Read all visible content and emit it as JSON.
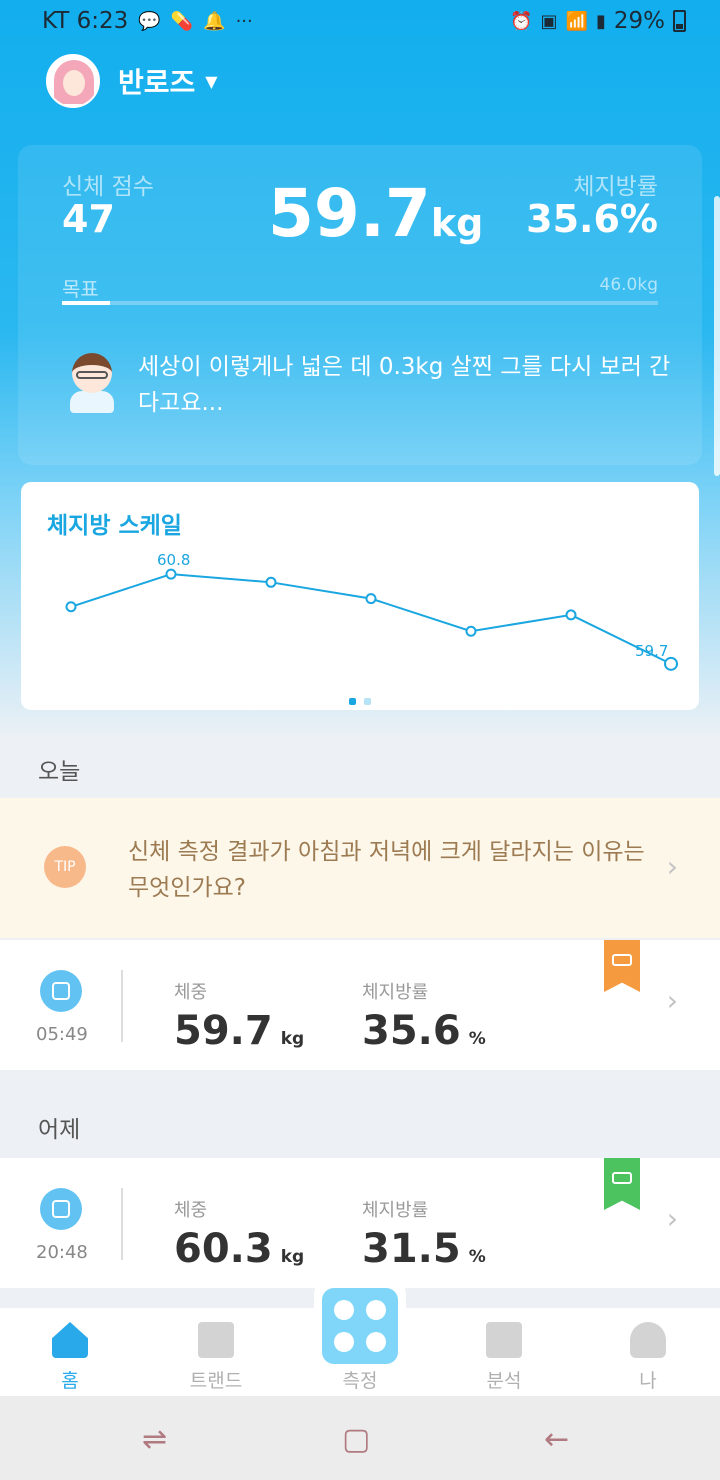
{
  "status_bar": {
    "left_text": "KT 6:23",
    "right_text": "29%",
    "icons": [
      "kakaotalk-icon",
      "pill-icon",
      "bell-icon",
      "more-icon",
      "alarm-icon",
      "hd-icon",
      "wifi-icon",
      "signal-icon",
      "battery-icon"
    ]
  },
  "profile": {
    "name": "반로즈"
  },
  "summary": {
    "score_label": "신체 점수",
    "score_value": "47",
    "weight_value": "59.7",
    "weight_unit": "kg",
    "fat_label": "체지방률",
    "fat_value": "35.6%",
    "goal_label": "목표",
    "goal_value": "46.0kg",
    "goal_progress": 0.08,
    "coach_message": "세상이 이렇게나 넓은 데 0.3kg 살찐 그를 다시 보러 간다고요..."
  },
  "chart_data": {
    "type": "line",
    "title": "체지방 스케일",
    "series": [
      {
        "values": [
          60.4,
          60.8,
          60.7,
          60.5,
          60.1,
          60.3,
          59.7
        ]
      }
    ],
    "point_labels": [
      {
        "index": 1,
        "text": "60.8"
      },
      {
        "index": 6,
        "text": "59.7"
      }
    ],
    "ylim": [
      59.6,
      60.9
    ],
    "page_indicator": {
      "pages": 2,
      "current": 0
    },
    "color": "#1aa6e0"
  },
  "today": {
    "label": "오늘",
    "tip_badge": "TIP",
    "tip_text": "신체 측정 결과가 아침과 저녁에 크게 달라지는 이유는 무엇인가요?",
    "record": {
      "time": "05:49",
      "weight_label": "체중",
      "weight_value": "59.7",
      "weight_unit": "kg",
      "fat_label": "체지방률",
      "fat_value": "35.6",
      "fat_unit": "%",
      "ribbon_color": "#f59a3e"
    }
  },
  "yesterday": {
    "label": "어제",
    "record": {
      "time": "20:48",
      "weight_label": "체중",
      "weight_value": "60.3",
      "weight_unit": "kg",
      "fat_label": "체지방률",
      "fat_value": "31.5",
      "fat_unit": "%",
      "ribbon_color": "#4cc35f"
    }
  },
  "bottom_nav": {
    "items": [
      {
        "label": "홈",
        "icon": "home-icon",
        "active": true
      },
      {
        "label": "트랜드",
        "icon": "trend-icon",
        "active": false
      },
      {
        "label": "측정",
        "icon": "scale-icon",
        "active": false
      },
      {
        "label": "분석",
        "icon": "analysis-icon",
        "active": false
      },
      {
        "label": "나",
        "icon": "person-icon",
        "active": false
      }
    ]
  },
  "android_nav": {
    "icons": [
      "recent-apps-icon",
      "home-button-icon",
      "back-icon"
    ]
  },
  "colors": {
    "accent": "#1aa6e0",
    "hero_top": "#12aeee",
    "tip_bg": "#fdf7ea",
    "tip_text": "#9c7a52"
  }
}
